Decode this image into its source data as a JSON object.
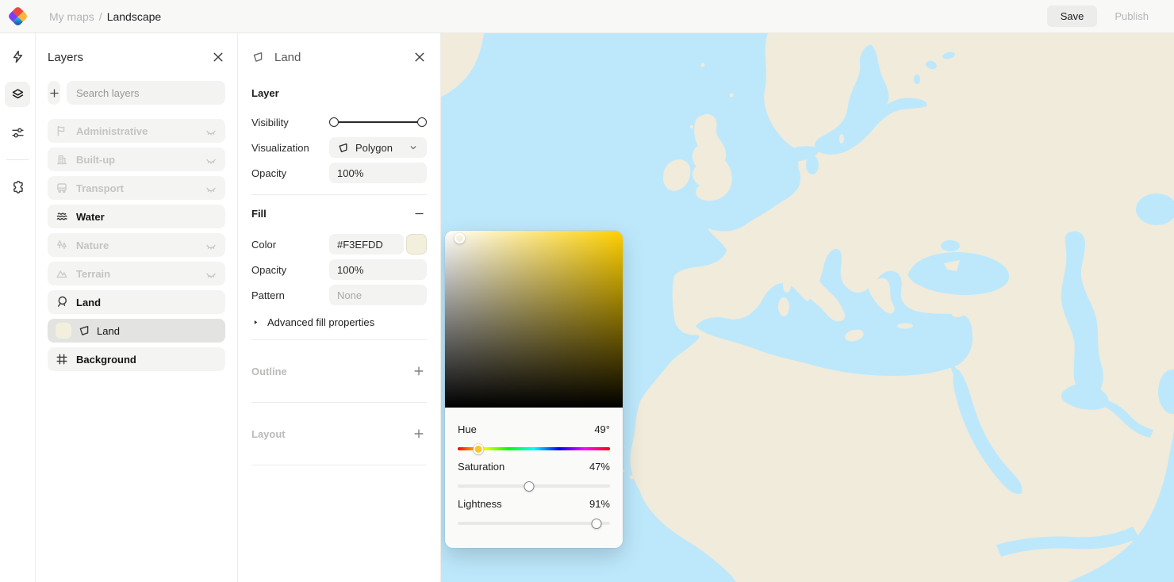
{
  "topbar": {
    "breadcrumb": {
      "parent": "My maps",
      "separator": "/",
      "current": "Landscape"
    },
    "save_label": "Save",
    "publish_label": "Publish"
  },
  "rail": {
    "items": [
      {
        "icon": "bolt-icon",
        "active": false
      },
      {
        "icon": "layers-icon",
        "active": true
      },
      {
        "icon": "sliders-icon",
        "active": false
      },
      {
        "icon": "puzzle-icon",
        "active": false
      }
    ]
  },
  "layers_panel": {
    "title": "Layers",
    "search_placeholder": "Search layers",
    "items": [
      {
        "label": "Administrative",
        "icon": "flag-icon",
        "muted": true,
        "hidden": true
      },
      {
        "label": "Built-up",
        "icon": "building-icon",
        "muted": true,
        "hidden": true
      },
      {
        "label": "Transport",
        "icon": "bus-icon",
        "muted": true,
        "hidden": true
      },
      {
        "label": "Water",
        "icon": "waves-icon",
        "muted": false,
        "hidden": false
      },
      {
        "label": "Nature",
        "icon": "trees-icon",
        "muted": true,
        "hidden": true
      },
      {
        "label": "Terrain",
        "icon": "mountain-icon",
        "muted": true,
        "hidden": true
      },
      {
        "label": "Land",
        "icon": "balloon-icon",
        "muted": false,
        "hidden": false
      },
      {
        "label": "Land",
        "icon": "polygon-icon",
        "sub": true,
        "selected": true,
        "swatch": "#F3EFDD"
      },
      {
        "label": "Background",
        "icon": "frame-icon",
        "muted": false,
        "hidden": false
      }
    ]
  },
  "inspector": {
    "title": "Land",
    "layer_section": {
      "heading": "Layer",
      "visibility_label": "Visibility",
      "visualization_label": "Visualization",
      "visualization_value": "Polygon",
      "opacity_label": "Opacity",
      "opacity_value": "100%"
    },
    "fill_section": {
      "heading": "Fill",
      "color_label": "Color",
      "color_value": "#F3EFDD",
      "opacity_label": "Opacity",
      "opacity_value": "100%",
      "pattern_label": "Pattern",
      "pattern_value": "None",
      "advanced_label": "Advanced fill properties"
    },
    "outline_section": {
      "heading": "Outline"
    },
    "layout_section": {
      "heading": "Layout"
    }
  },
  "color_picker": {
    "hue_label": "Hue",
    "hue_value": "49°",
    "hue_deg": 49,
    "saturation_label": "Saturation",
    "saturation_value": "47%",
    "saturation_pct": 47,
    "lightness_label": "Lightness",
    "lightness_value": "91%",
    "lightness_pct": 91
  },
  "map": {
    "water_color": "#BDE8FC",
    "land_color": "#F0EBDB"
  }
}
